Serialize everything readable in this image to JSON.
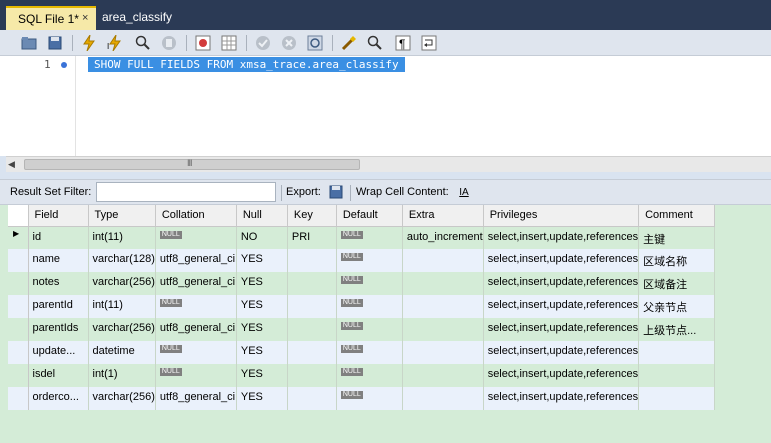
{
  "tabs": [
    {
      "label": "SQL File 1*",
      "close": "×"
    },
    {
      "label": "area_classify"
    }
  ],
  "editor": {
    "line_number": "1",
    "query": "SHOW FULL FIELDS FROM xmsa_trace.area_classify"
  },
  "scrollbar": {
    "grip": "III"
  },
  "filterbar": {
    "filter_label": "Result Set Filter:",
    "filter_value": "",
    "export_label": "Export:",
    "wrap_label": "Wrap Cell Content:",
    "wrap_icon": "IA"
  },
  "grid": {
    "null_badge": "NULL",
    "columns": [
      "Field",
      "Type",
      "Collation",
      "Null",
      "Key",
      "Default",
      "Extra",
      "Privileges",
      "Comment"
    ],
    "rows": [
      {
        "field": "id",
        "type": "int(11)",
        "collation": "NULL",
        "null": "NO",
        "key": "PRI",
        "default": "NULL",
        "extra": "auto_increment",
        "privileges": "select,insert,update,references",
        "comment": "主键"
      },
      {
        "field": "name",
        "type": "varchar(128)",
        "collation": "utf8_general_ci",
        "null": "YES",
        "key": "",
        "default": "NULL",
        "extra": "",
        "privileges": "select,insert,update,references",
        "comment": "区域名称"
      },
      {
        "field": "notes",
        "type": "varchar(256)",
        "collation": "utf8_general_ci",
        "null": "YES",
        "key": "",
        "default": "NULL",
        "extra": "",
        "privileges": "select,insert,update,references",
        "comment": "区域备注"
      },
      {
        "field": "parentId",
        "type": "int(11)",
        "collation": "NULL",
        "null": "YES",
        "key": "",
        "default": "NULL",
        "extra": "",
        "privileges": "select,insert,update,references",
        "comment": "父亲节点"
      },
      {
        "field": "parentIds",
        "type": "varchar(256)",
        "collation": "utf8_general_ci",
        "null": "YES",
        "key": "",
        "default": "NULL",
        "extra": "",
        "privileges": "select,insert,update,references",
        "comment": "上级节点..."
      },
      {
        "field": "update...",
        "type": "datetime",
        "collation": "NULL",
        "null": "YES",
        "key": "",
        "default": "NULL",
        "extra": "",
        "privileges": "select,insert,update,references",
        "comment": ""
      },
      {
        "field": "isdel",
        "type": "int(1)",
        "collation": "NULL",
        "null": "YES",
        "key": "",
        "default": "NULL",
        "extra": "",
        "privileges": "select,insert,update,references",
        "comment": ""
      },
      {
        "field": "orderco...",
        "type": "varchar(256)",
        "collation": "utf8_general_ci",
        "null": "YES",
        "key": "",
        "default": "NULL",
        "extra": "",
        "privileges": "select,insert,update,references",
        "comment": ""
      }
    ]
  }
}
